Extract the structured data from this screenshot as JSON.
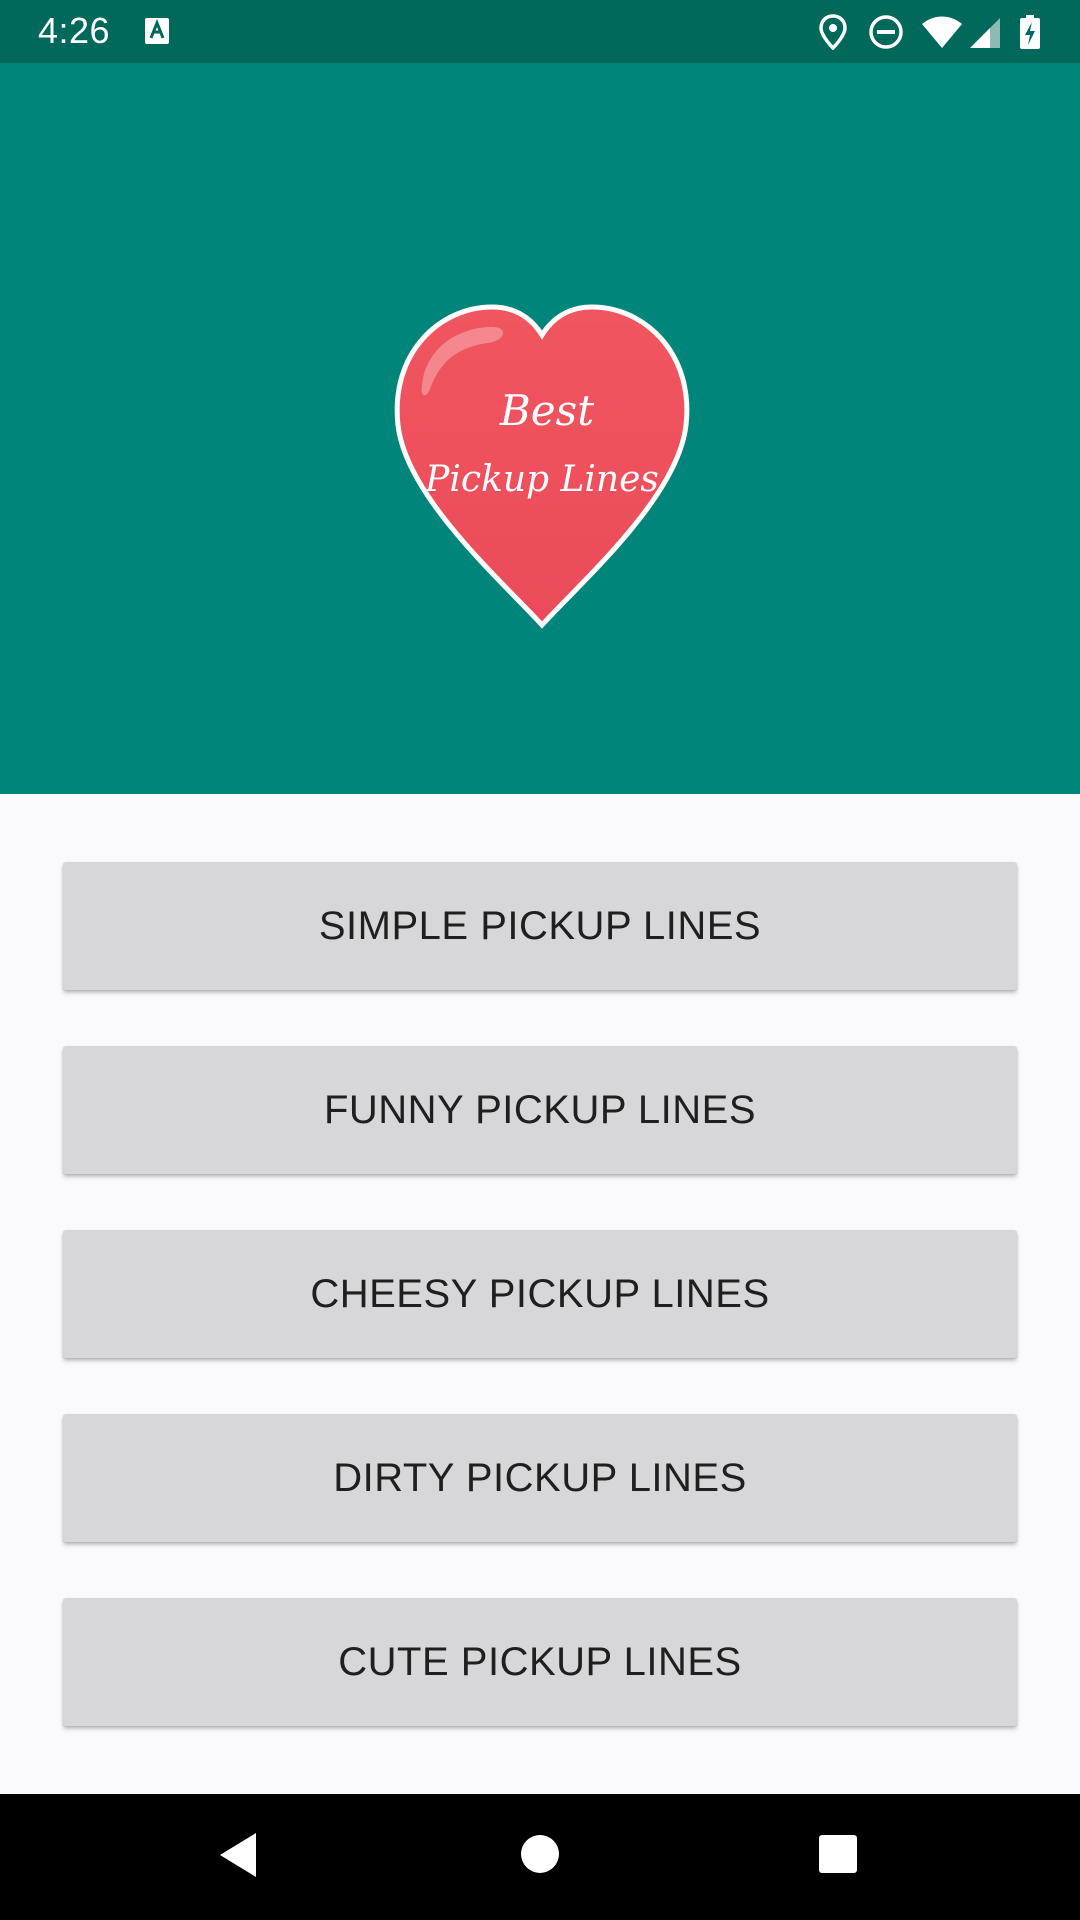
{
  "status_bar": {
    "time": "4:26",
    "icons": [
      "a-notification-icon",
      "location-icon",
      "do-not-disturb-icon",
      "wifi-icon",
      "signal-icon",
      "battery-charging-icon"
    ]
  },
  "header": {
    "background_color": "#00857a",
    "logo": {
      "icon": "heart-logo-icon",
      "line1": "Best",
      "line2": "Pickup Lines",
      "heart_color": "#ef4f5e"
    }
  },
  "menu": {
    "buttons": [
      {
        "label": "SIMPLE PICKUP LINES"
      },
      {
        "label": "FUNNY PICKUP LINES"
      },
      {
        "label": "CHEESY PICKUP LINES"
      },
      {
        "label": "DIRTY PICKUP LINES"
      },
      {
        "label": "CUTE PICKUP LINES"
      }
    ]
  },
  "nav_bar": {
    "icons": [
      "back-icon",
      "home-icon",
      "recents-icon"
    ]
  }
}
